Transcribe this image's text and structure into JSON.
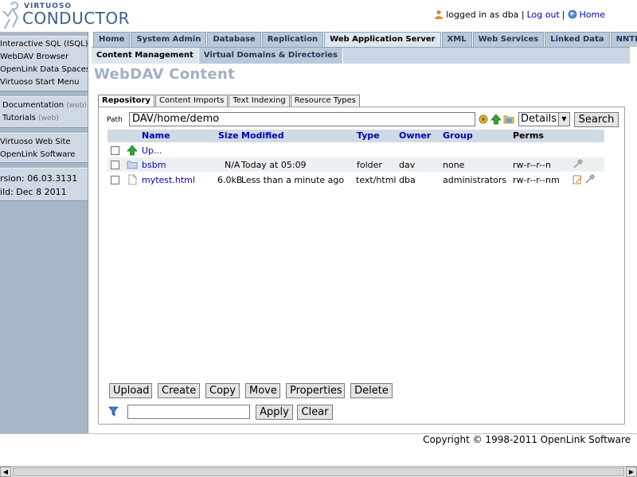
{
  "brand": {
    "line1": "VIRTUOSO",
    "line2": "CONDUCTOR",
    "logo_color": "#3a5f8c"
  },
  "user": {
    "text": "logged in as dba |",
    "logout": "Log out",
    "separator": "|",
    "home": "Home"
  },
  "sidebar": {
    "group1": [
      "Interactive SQL (ISQL)",
      "WebDAV Browser",
      "OpenLink Data Spaces",
      "Virtuoso Start Menu"
    ],
    "group2": [
      {
        "label": "Documentation",
        "suffix": "(web)"
      },
      {
        "label": "Tutorials",
        "suffix": "(web)"
      }
    ],
    "group3": [
      "Virtuoso Web Site",
      "OpenLink Software"
    ],
    "version": [
      "rsion: 06.03.3131",
      "ild: Dec 8 2011"
    ]
  },
  "tabs": [
    {
      "label": "Home",
      "active": false
    },
    {
      "label": "System Admin",
      "active": false
    },
    {
      "label": "Database",
      "active": false
    },
    {
      "label": "Replication",
      "active": false
    },
    {
      "label": "Web Application Server",
      "active": true
    },
    {
      "label": "XML",
      "active": false
    },
    {
      "label": "Web Services",
      "active": false
    },
    {
      "label": "Linked Data",
      "active": false
    },
    {
      "label": "NNTP",
      "active": false
    }
  ],
  "subtabs": [
    {
      "label": "Content Management",
      "active": true
    },
    {
      "label": "Virtual Domains & Directories",
      "active": false
    }
  ],
  "page_title": "WebDAV Content",
  "panel_tabs": [
    {
      "label": "Repository",
      "active": true
    },
    {
      "label": "Content Imports",
      "active": false
    },
    {
      "label": "Text Indexing",
      "active": false
    },
    {
      "label": "Resource Types",
      "active": false
    }
  ],
  "path": {
    "label": "Path",
    "value": "DAV/home/demo"
  },
  "view": {
    "selected": "Details"
  },
  "search_label": "Search",
  "table": {
    "headers": {
      "name": "Name",
      "size": "Size",
      "modified": "Modified",
      "type": "Type",
      "owner": "Owner",
      "group": "Group",
      "perms": "Perms"
    },
    "up_label": "Up...",
    "rows": [
      {
        "name": "bsbm",
        "size": "N/A",
        "modified": "Today at 05:09",
        "type": "folder",
        "owner": "dav",
        "group": "none",
        "perms": "rw-r--r--n"
      },
      {
        "name": "mytest.html",
        "size": "6.0kB",
        "modified": "Less than a minute ago",
        "type": "text/html",
        "owner": "dba",
        "group": "administrators",
        "perms": "rw-r--r--nm"
      }
    ]
  },
  "actions": [
    "Upload",
    "Create",
    "Copy",
    "Move",
    "Properties",
    "Delete"
  ],
  "filter": {
    "value": "",
    "apply": "Apply",
    "clear": "Clear"
  },
  "copyright": "Copyright © 1998-2011 OpenLink Software",
  "colors": {
    "sidebar_bg": "#a7b7c8",
    "tab_bg": "#b9c9da",
    "header_text": "#0000b8",
    "link": "#0000cc"
  }
}
